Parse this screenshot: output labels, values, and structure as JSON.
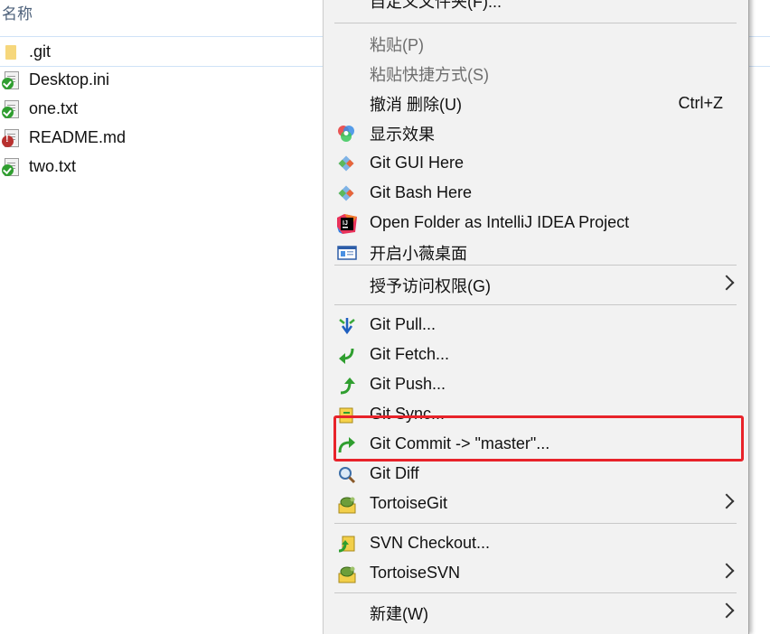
{
  "explorer": {
    "column_header": "名称",
    "files": [
      {
        "name": ".git",
        "icon": "folder-icon",
        "status": "none"
      },
      {
        "name": "Desktop.ini",
        "icon": "document-icon",
        "status": "normal"
      },
      {
        "name": "one.txt",
        "icon": "document-icon",
        "status": "normal"
      },
      {
        "name": "README.md",
        "icon": "document-icon",
        "status": "modified"
      },
      {
        "name": "two.txt",
        "icon": "document-icon",
        "status": "normal"
      }
    ]
  },
  "menu": {
    "items": [
      {
        "label": "自定义文件夹(F)...",
        "icon": "none",
        "disabled": false
      },
      {
        "label": "粘贴(P)",
        "icon": "none",
        "disabled": true
      },
      {
        "label": "粘贴快捷方式(S)",
        "icon": "none",
        "disabled": true
      },
      {
        "label": "撤消 删除(U)",
        "shortcut": "Ctrl+Z",
        "icon": "none",
        "disabled": false
      },
      {
        "label": "显示效果",
        "icon": "color-wheel-icon"
      },
      {
        "label": "Git GUI Here",
        "icon": "git-diamond-icon"
      },
      {
        "label": "Git Bash Here",
        "icon": "git-diamond-icon"
      },
      {
        "label": "Open Folder as IntelliJ IDEA Project",
        "icon": "intellij-icon"
      },
      {
        "label": "开启小薇桌面",
        "icon": "desktop-window-icon"
      },
      {
        "label": "授予访问权限(G)",
        "icon": "none",
        "submenu": true
      },
      {
        "label": "Git Pull...",
        "icon": "git-pull-icon"
      },
      {
        "label": "Git Fetch...",
        "icon": "git-fetch-icon"
      },
      {
        "label": "Git Push...",
        "icon": "git-push-icon"
      },
      {
        "label": "Git Sync...",
        "icon": "git-sync-icon"
      },
      {
        "label": "Git Commit -> \"master\"...",
        "icon": "git-commit-icon"
      },
      {
        "label": "Git Diff",
        "icon": "magnifier-icon"
      },
      {
        "label": "TortoiseGit",
        "icon": "tortoise-icon",
        "submenu": true
      },
      {
        "label": "SVN Checkout...",
        "icon": "svn-checkout-icon"
      },
      {
        "label": "TortoiseSVN",
        "icon": "tortoise-icon",
        "submenu": true
      },
      {
        "label": "新建(W)",
        "icon": "none",
        "submenu": true
      }
    ]
  },
  "colors": {
    "menu_bg": "#f2f2f2",
    "highlight_border": "#e8232a",
    "git_green": "#2f9e2f",
    "header_text": "#4c607a"
  }
}
